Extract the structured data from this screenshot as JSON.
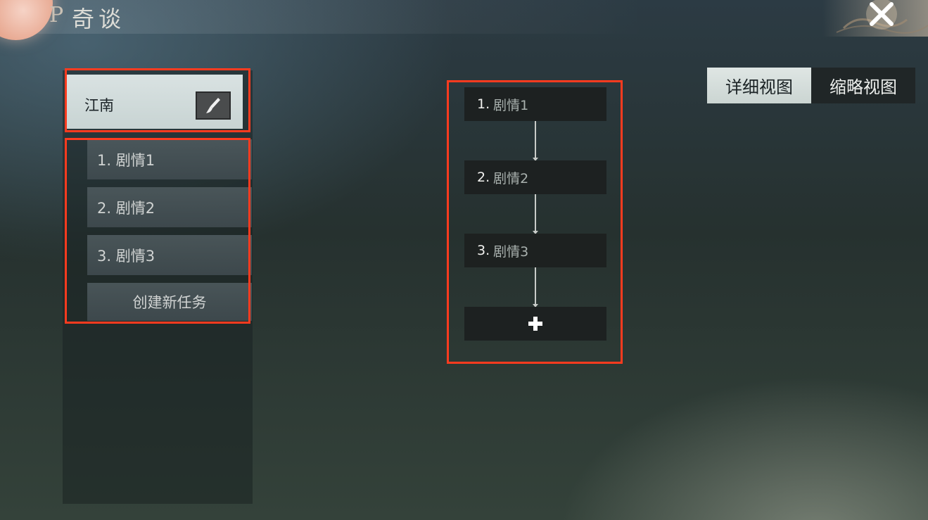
{
  "header": {
    "glyph": "P",
    "title": "奇谈",
    "close_icon": "close-x-icon"
  },
  "left_panel": {
    "region_name": "江南",
    "edit_icon": "brush-icon",
    "tasks": [
      {
        "label": "1. 剧情1"
      },
      {
        "label": "2. 剧情2"
      },
      {
        "label": "3. 剧情3"
      }
    ],
    "create_label": "创建新任务"
  },
  "view_toggle": {
    "detail_label": "详细视图",
    "brief_label": "缩略视图",
    "selected": "detail"
  },
  "flow": {
    "nodes": [
      {
        "num": "1.",
        "name": "剧情1"
      },
      {
        "num": "2.",
        "name": "剧情2"
      },
      {
        "num": "3.",
        "name": "剧情3"
      }
    ],
    "add_icon": "plus-icon"
  },
  "colors": {
    "highlight": "#ff3b1f",
    "selected_tab": "#dfe6e4",
    "panel_header": "#d9e2e2"
  }
}
